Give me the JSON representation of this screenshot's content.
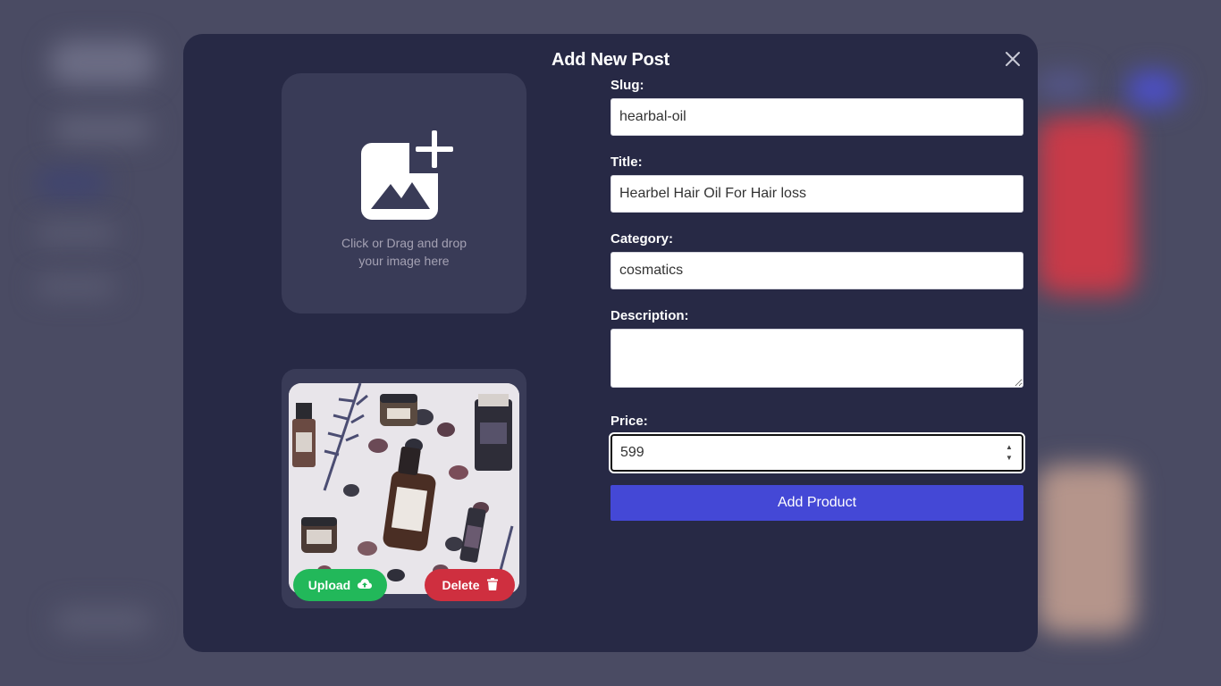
{
  "modal": {
    "title": "Add New Post"
  },
  "dropzone": {
    "line1": "Click or Drag and drop",
    "line2": "your image here"
  },
  "preview": {
    "upload_label": "Upload",
    "delete_label": "Delete"
  },
  "form": {
    "slug_label": "Slug:",
    "slug_value": "hearbal-oil",
    "title_label": "Title:",
    "title_value": "Hearbel Hair Oil For Hair loss",
    "category_label": "Category:",
    "category_value": "cosmatics",
    "description_label": "Description:",
    "description_value": "",
    "price_label": "Price:",
    "price_value": "599",
    "submit_label": "Add Product"
  },
  "colors": {
    "modal_bg": "#272945",
    "card_bg": "#393b57",
    "upload_green": "#22b85a",
    "delete_red": "#cf2f3f",
    "submit_blue": "#4448d6"
  },
  "icons": {
    "close": "close-icon",
    "add_image": "add-image-icon",
    "upload": "cloud-upload-icon",
    "delete": "trash-icon"
  }
}
